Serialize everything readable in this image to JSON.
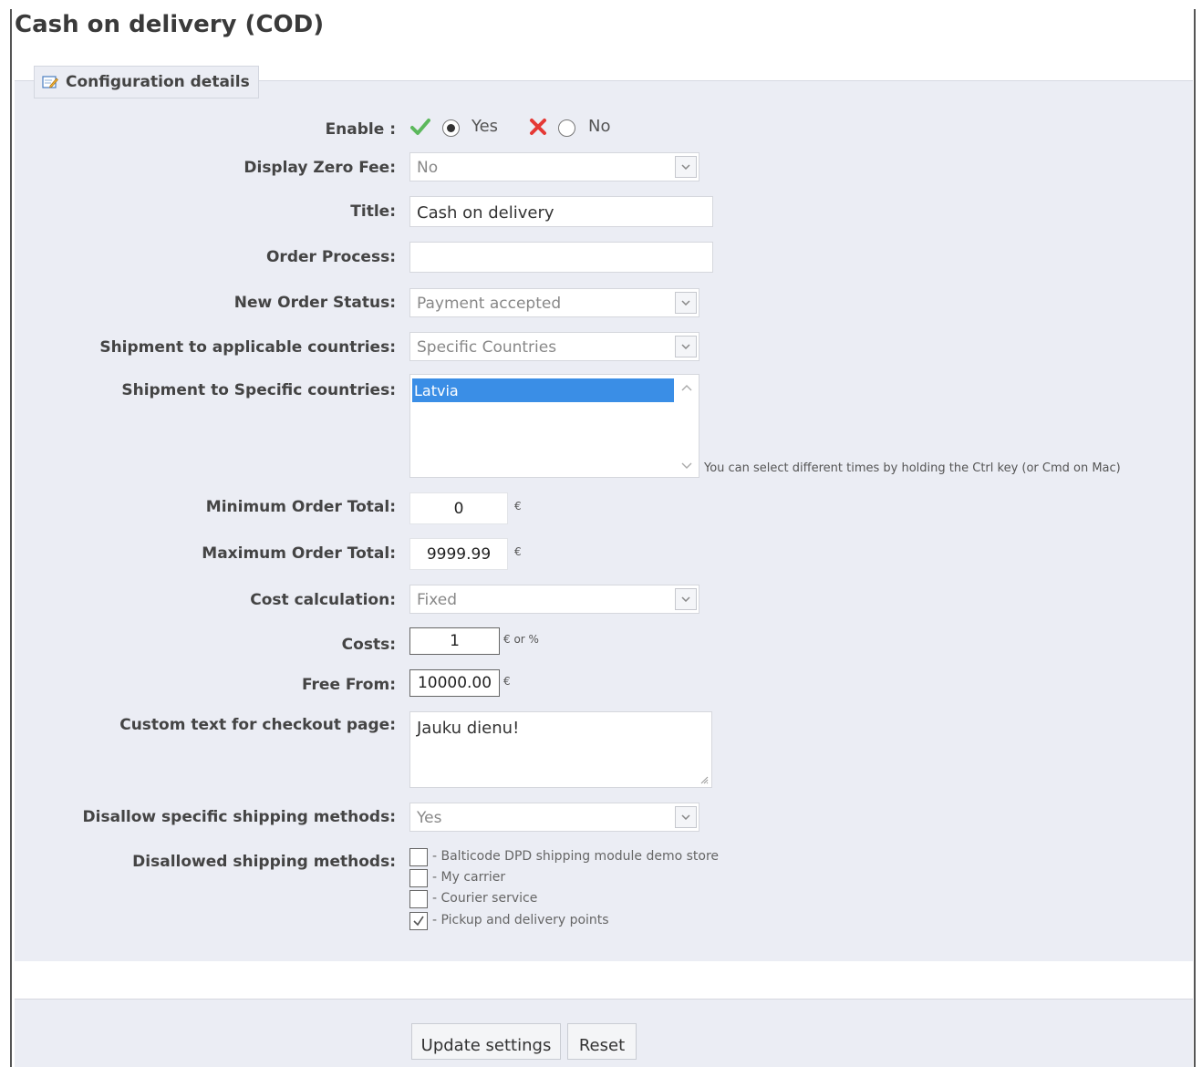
{
  "page": {
    "title": "Cash on delivery (COD)"
  },
  "panel": {
    "legend": "Configuration details",
    "legend_icon": "edit-form-icon"
  },
  "form": {
    "enable": {
      "label": "Enable :",
      "yes": "Yes",
      "no": "No",
      "selected": "Yes"
    },
    "display_zero_fee": {
      "label": "Display Zero Fee:",
      "value": "No"
    },
    "title": {
      "label": "Title:",
      "value": "Cash on delivery"
    },
    "order_process": {
      "label": "Order Process:",
      "value": ""
    },
    "new_order_status": {
      "label": "New Order Status:",
      "value": "Payment accepted"
    },
    "shipment_applicable": {
      "label": "Shipment to applicable countries:",
      "value": "Specific Countries"
    },
    "shipment_specific": {
      "label": "Shipment to Specific countries:",
      "options": [
        "Latvia"
      ],
      "hint": "You can select different times by holding the Ctrl key (or Cmd on Mac)"
    },
    "minimum_order_total": {
      "label": "Minimum Order Total:",
      "value": "0",
      "unit": "€"
    },
    "maximum_order_total": {
      "label": "Maximum Order Total:",
      "value": "9999.99",
      "unit": "€"
    },
    "cost_calculation": {
      "label": "Cost calculation:",
      "value": "Fixed"
    },
    "costs": {
      "label": "Costs:",
      "value": "1",
      "unit": "€ or %"
    },
    "free_from": {
      "label": "Free From:",
      "value": "10000.00",
      "unit": "€"
    },
    "custom_text": {
      "label": "Custom text for checkout page:",
      "value": "Jauku dienu!"
    },
    "disallow_specific": {
      "label": "Disallow specific shipping methods:",
      "value": "Yes"
    },
    "disallowed_methods": {
      "label": "Disallowed shipping methods:",
      "items": [
        {
          "label": "- Balticode DPD shipping module demo store",
          "checked": false
        },
        {
          "label": "- My carrier",
          "checked": false
        },
        {
          "label": "- Courier service",
          "checked": false
        },
        {
          "label": "- Pickup and delivery points",
          "checked": true
        }
      ]
    }
  },
  "buttons": {
    "update": "Update settings",
    "reset": "Reset"
  },
  "colors": {
    "panel_bg": "#ebedf4",
    "selection_blue": "#3a8ee6",
    "check_green": "#5cb85c",
    "cross_red": "#e53935"
  }
}
